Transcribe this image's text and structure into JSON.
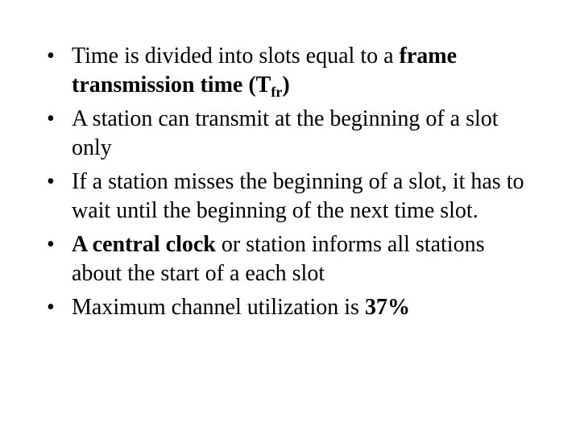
{
  "bullets": [
    {
      "parts": [
        {
          "text": "Time is divided into slots equal to a ",
          "bold": false
        },
        {
          "text": "frame transmission time (T",
          "bold": true
        },
        {
          "text": "fr",
          "bold": true,
          "sub": true
        },
        {
          "text": ")",
          "bold": true
        }
      ]
    },
    {
      "parts": [
        {
          "text": "A station can transmit at the beginning of a slot only",
          "bold": false
        }
      ]
    },
    {
      "parts": [
        {
          "text": "If a station misses the beginning of a slot, it has to wait until the beginning of the next time slot.",
          "bold": false
        }
      ]
    },
    {
      "parts": [
        {
          "text": "A central clock",
          "bold": true
        },
        {
          "text": " or station informs all stations about the start of a each slot",
          "bold": false
        }
      ]
    },
    {
      "parts": [
        {
          "text": "Maximum channel utilization is ",
          "bold": false
        },
        {
          "text": "37%",
          "bold": true
        }
      ]
    }
  ],
  "bullet_glyph": "•"
}
